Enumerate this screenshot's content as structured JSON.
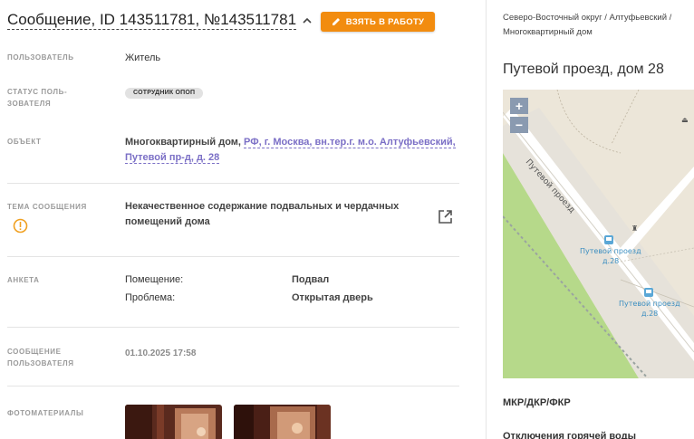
{
  "header": {
    "title": "Сообщение, ID 143511781, №143511781",
    "take_button_label": "ВЗЯТЬ В РАБОТУ"
  },
  "fields": {
    "user_label": "ПОЛЬЗОВАТЕЛЬ",
    "user_value": "Житель",
    "status_label_1": "СТАТУС ПОЛЬ-",
    "status_label_2": "ЗОВАТЕЛЯ",
    "status_badge": "СОТРУДНИК ОПОП",
    "object_label": "ОБЪЕКТ",
    "object_prefix": "Многоквартирный дом,",
    "object_link_1": "РФ, г. Москва, вн.тер.г. м.о. Алтуфьевский,",
    "object_link_2": "Путевой пр-д, д. 28",
    "topic_label": "ТЕМА СООБЩЕНИЯ",
    "topic_value_1": "Некачественное содержание подвальных и чердачных",
    "topic_value_2": "помещений дома",
    "survey_label": "АНКЕТА",
    "survey": [
      {
        "key": "Помещение:",
        "value": "Подвал"
      },
      {
        "key": "Проблема:",
        "value": "Открытая дверь"
      }
    ],
    "message_label_1": "СООБЩЕНИЕ",
    "message_label_2": "ПОЛЬЗОВАТЕЛЯ",
    "message_value": "01.10.2025 17:58",
    "photos_label": "ФОТОМАТЕРИАЛЫ"
  },
  "side": {
    "breadcrumb_1": "Северо-Восточный округ / Алтуфьевский /",
    "breadcrumb_2": "Многоквартирный дом",
    "address": "Путевой проезд, дом 28",
    "map": {
      "zoom_in": "+",
      "zoom_out": "−",
      "street_label": "Путевой проезд",
      "stop1_line1": "Путевой проезд",
      "stop1_line2": "д.28",
      "stop2_line1": "Путевой проезд",
      "stop2_line2": "д.28"
    },
    "section_1": "МКР/ДКР/ФКР",
    "section_2": "Отключения горячей воды"
  },
  "colors": {
    "accent": "#f28c0f",
    "link": "#7b6fc6",
    "warning": "#f0a020"
  },
  "icons": [
    "pencil-icon",
    "chevron-up-icon",
    "warning-icon",
    "external-link-icon",
    "bus-stop-icon"
  ]
}
